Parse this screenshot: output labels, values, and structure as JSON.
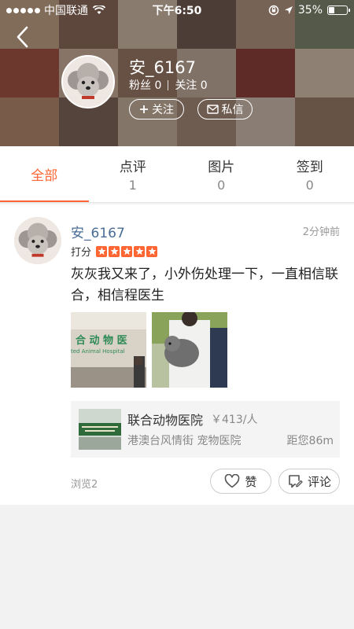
{
  "status_bar": {
    "carrier": "中国联通",
    "time": "下午6:50",
    "battery": "35%",
    "battery_level": 0.35
  },
  "header": {
    "back_icon": "chevron-left-icon",
    "username": "安_6167",
    "fans_label": "粉丝 0",
    "following_label": "关注 0",
    "follow_button": "关注",
    "message_button": "私信"
  },
  "tabs": [
    {
      "label": "全部",
      "count": "",
      "active": true
    },
    {
      "label": "点评",
      "count": "1",
      "active": false
    },
    {
      "label": "图片",
      "count": "0",
      "active": false
    },
    {
      "label": "签到",
      "count": "0",
      "active": false
    }
  ],
  "post": {
    "author": "安_6167",
    "time": "2分钟前",
    "rating_label": "打分",
    "rating_stars": 5,
    "text": "灰灰我又来了，小外伤处理一下，一直相信联合，相信程医生",
    "photo1_sign": "合 动 物 医",
    "photo1_sign_en": "ted  Animal  Hospital",
    "shop": {
      "name": "联合动物医院",
      "price": "￥413/人",
      "address": "港澳台风情街 宠物医院",
      "distance": "距您86m"
    },
    "views": "浏览2",
    "like_button": "赞",
    "comment_button": "评论"
  },
  "colors": {
    "accent": "#ff6633",
    "author_link": "#4a6d96"
  }
}
